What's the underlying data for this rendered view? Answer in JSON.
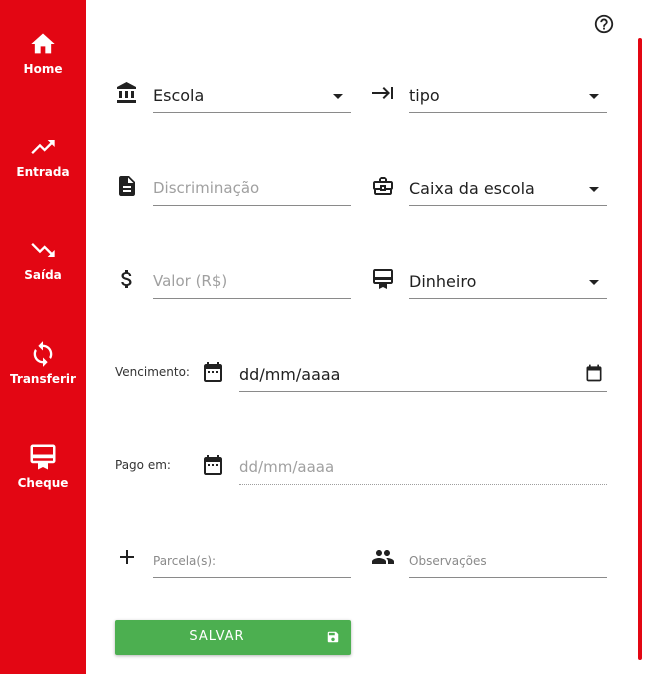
{
  "sidebar": {
    "items": [
      {
        "label": "Home",
        "icon": "home-icon"
      },
      {
        "label": "Entrada",
        "icon": "trending-up-icon"
      },
      {
        "label": "Saída",
        "icon": "trending-down-icon"
      },
      {
        "label": "Transferir",
        "icon": "sync-icon"
      },
      {
        "label": "Cheque",
        "icon": "cheque-icon"
      }
    ]
  },
  "header": {
    "help_icon": "help-circle-icon"
  },
  "form": {
    "escola": {
      "value": "Escola",
      "icon": "bank-icon"
    },
    "tipo": {
      "value": "tipo",
      "icon": "arrow-to-right-icon"
    },
    "discriminacao": {
      "placeholder": "Discriminação",
      "icon": "document-icon"
    },
    "caixa": {
      "value": "Caixa da escola",
      "icon": "briefcase-icon"
    },
    "valor": {
      "placeholder": "Valor (R$)",
      "icon": "dollar-icon"
    },
    "forma_pagamento": {
      "value": "Dinheiro",
      "icon": "card-icon"
    },
    "vencimento": {
      "label": "Vencimento:",
      "value": "dd/mm/aaaa",
      "icon": "calendar-icon"
    },
    "pago_em": {
      "label": "Pago em:",
      "placeholder": "dd/mm/aaaa",
      "icon": "calendar-icon"
    },
    "parcelas": {
      "placeholder": "Parcela(s):",
      "icon": "plus-icon"
    },
    "observacoes": {
      "placeholder": "Observações",
      "icon": "people-icon"
    },
    "save_label": "SALVAR"
  },
  "colors": {
    "brand": "#e30613",
    "save": "#4caf50"
  }
}
